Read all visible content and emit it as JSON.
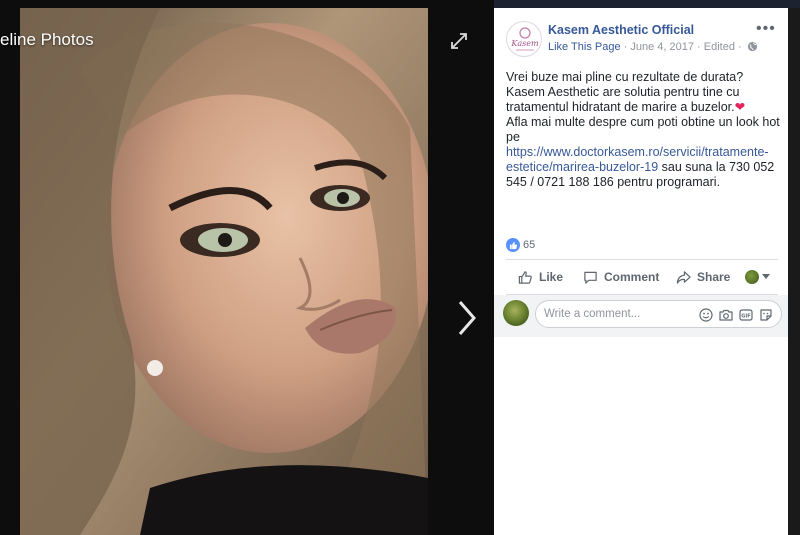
{
  "theater": {
    "album_title": "eline Photos",
    "expand_icon": "expand-arrows-icon",
    "next_icon": "chevron-right-icon"
  },
  "post": {
    "page_name": "Kasem Aesthetic Official",
    "like_page": "Like This Page",
    "separator": " · ",
    "date": "June 4, 2017",
    "edited": "Edited",
    "privacy_icon": "globe-icon",
    "more_icon": "more-options-icon",
    "text_1": "Vrei buze mai pline cu rezultate de durata?",
    "text_2": "Kasem Aesthetic are solutia pentru tine cu tratamentul hidratant de marire a buzelor.",
    "heart": "❤",
    "text_3": "Afla mai multe despre cum poti obtine un look hot pe ",
    "link": "https://www.doctorkasem.ro/servicii/tratamente-estetice/marirea-buzelor-19",
    "text_4": " sau suna la 730 052 545 / 0721 188 186 pentru programari.",
    "reaction_count": "65",
    "reaction_color": "#5890ff"
  },
  "actions": {
    "like": "Like",
    "comment": "Comment",
    "share": "Share"
  },
  "comment": {
    "placeholder": "Write a comment..."
  },
  "colors": {
    "link": "#365899",
    "meta": "#90949c",
    "heart": "#e0245e"
  }
}
